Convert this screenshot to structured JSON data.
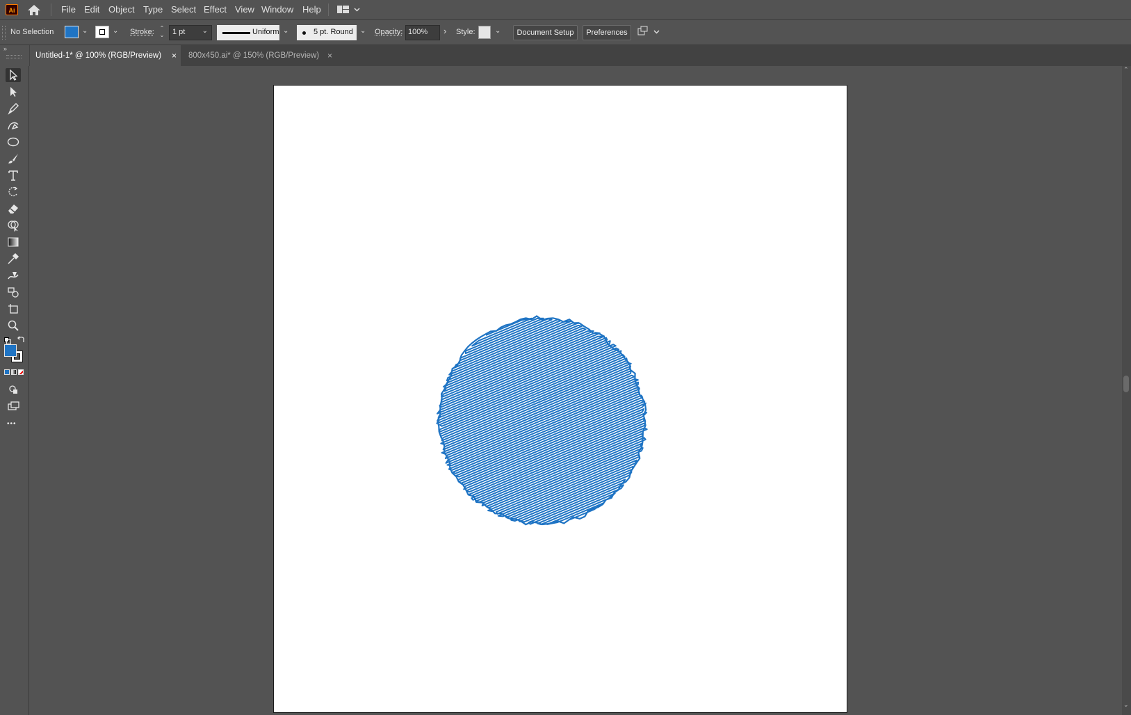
{
  "app": {
    "logo": "Ai"
  },
  "menu": {
    "items": [
      "File",
      "Edit",
      "Object",
      "Type",
      "Select",
      "Effect",
      "View",
      "Window",
      "Help"
    ]
  },
  "controlbar": {
    "selection_status": "No Selection",
    "fill_color": "#1f74c4",
    "stroke_label": "Stroke:",
    "stroke_weight": "1 pt",
    "profile": "Uniform",
    "brush": "5 pt. Round",
    "opacity_label": "Opacity:",
    "opacity_value": "100%",
    "style_label": "Style:",
    "document_setup": "Document Setup",
    "preferences": "Preferences"
  },
  "tabs": [
    {
      "label": "Untitled-1* @ 100% (RGB/Preview)",
      "active": true,
      "close": "×"
    },
    {
      "label": "800x450.ai* @ 150% (RGB/Preview)",
      "active": false,
      "close": "×"
    }
  ],
  "toolbar": {
    "more": "•••",
    "fill_color": "#1f74c4",
    "tools": [
      "selection-tool",
      "direct-selection-tool",
      "pen-tool",
      "curvature-tool",
      "ellipse-tool",
      "paintbrush-tool",
      "type-tool",
      "rotate-tool",
      "eraser-tool",
      "shape-builder-tool",
      "gradient-tool",
      "eyedropper-tool",
      "width-tool",
      "live-paint-tool",
      "artboard-tool",
      "zoom-tool"
    ]
  },
  "artwork": {
    "shape": "scribble-circle",
    "color": "#1f74c4"
  }
}
